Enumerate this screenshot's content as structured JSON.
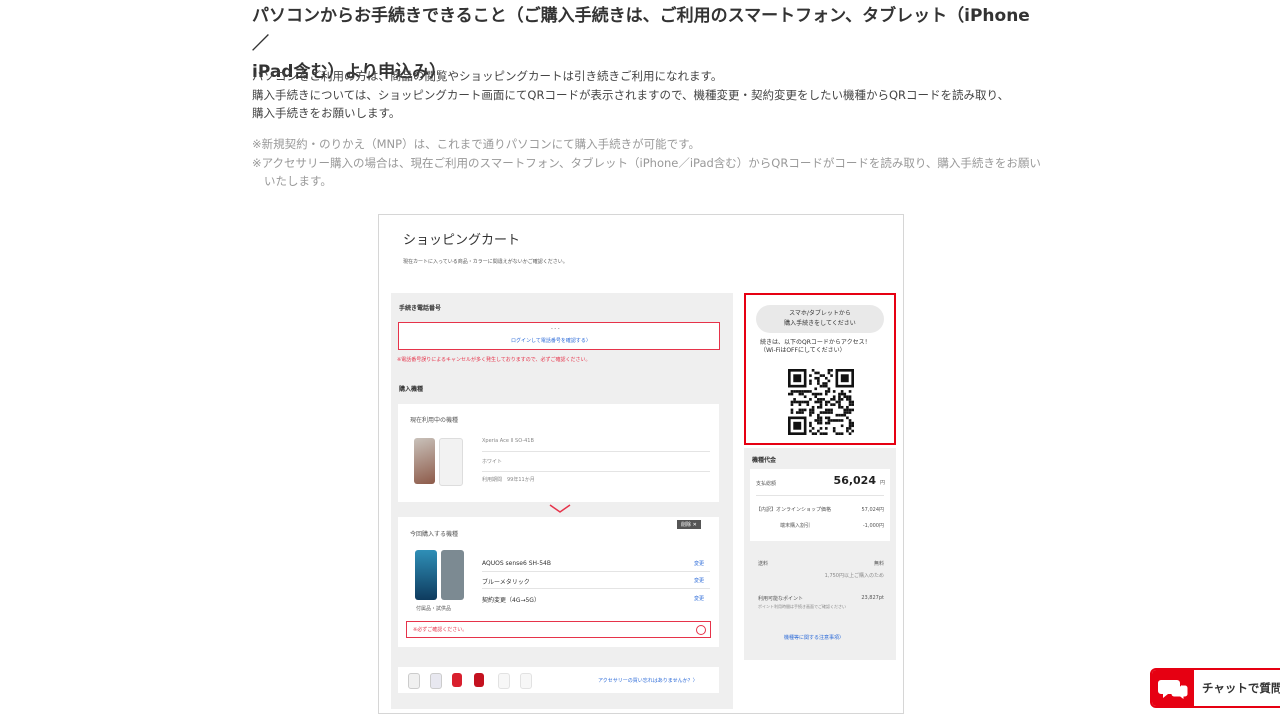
{
  "heading": {
    "line1": "パソコンからお手続きできること（ご購入手続きは、ご利用のスマートフォン、タブレット（iPhone／",
    "line2": "iPad含む）より申込み）"
  },
  "intro": [
    "パソコンをご利用の方は、商品の閲覧やショッピングカートは引き続きご利用になれます。",
    "購入手続きについては、ショッピングカート画面にてQRコードが表示されますので、機種変更・契約変更をしたい機種からQRコードを読み取り、",
    "購入手続きをお願いします。"
  ],
  "notes": [
    "※新規契約・のりかえ（MNP）は、これまで通りパソコンにて購入手続きが可能です。",
    "※アクセサリー購入の場合は、現在ご利用のスマートフォン、タブレット（iPhone／iPad含む）からQRコードがコードを読み取り、購入手続きをお願いいたします。"
  ],
  "cart": {
    "title": "ショッピングカート",
    "subtitle": "現在カートに入っている商品・カラーに間違えがないかご確認ください。",
    "phone_number_label": "手続き電話番号",
    "phone_number_dots": "- - -",
    "login_link": "ログインして電話番号を確認する〉",
    "warning": "※電話番号誤りによるキャンセルが多く発生しておりますので、必ずご確認ください。",
    "device_section_label": "購入機種",
    "current": {
      "label": "現在利用中の機種",
      "model": "Xperia Ace II SO-41B",
      "color": "ホワイト",
      "period": "利用期間　99年11か月"
    },
    "new": {
      "label": "今回購入する機種",
      "delete": "削除 ✕",
      "model": "AQUOS sense6 SH-54B",
      "color": "ブルーメタリック",
      "plan": "契約変更（4G→5G）",
      "change": "変更",
      "accessories_note": "付属品・試供品",
      "confirm": "※必ずご確認ください。"
    },
    "accessory_link": "アクセサリーの買い忘れはありませんか？〉",
    "qr_panel": {
      "pill_line1": "スマホ/タブレットから",
      "pill_line2": "購入手続きをしてください",
      "instructions": "続きは、以下のQRコードからアクセス！（Wi-FiはOFFにしてください）"
    },
    "price": {
      "label": "機種代金",
      "total_label": "支払総額",
      "total_value": "56,024",
      "total_unit": "円",
      "breakdown_label": "【内訳】オンラインショップ価格",
      "breakdown_value": "57,024円",
      "discount_label": "端末購入割引",
      "discount_value": "-1,000円",
      "shipping_label": "送料",
      "shipping_value": "無料",
      "shipping_note": "1,750円以上ご購入のため",
      "points_label": "利用可能なポイント",
      "points_value": "23,827pt",
      "points_note": "ポイント利用時間は手続き画面でご確認ください",
      "notes_link": "機種等に関する注意事項〉"
    }
  },
  "chat": {
    "label": "チャットで質問"
  },
  "colors": {
    "accent_red": "#e60012",
    "link_blue": "#2b6ad8"
  }
}
